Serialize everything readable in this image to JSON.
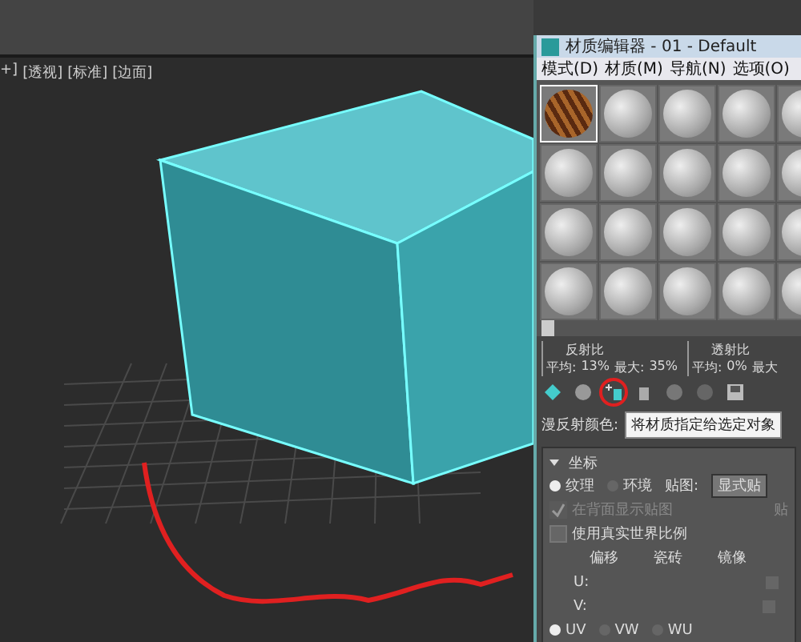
{
  "viewport": {
    "labels": [
      "+]",
      "[透视]",
      "[标准]",
      "[边面]"
    ]
  },
  "material_editor": {
    "title": "材质编辑器 - 01 - Default",
    "menu": [
      "模式(D)",
      "材质(M)",
      "导航(N)",
      "选项(O)"
    ],
    "slots": [
      {
        "kind": "wood",
        "selected": true
      },
      {
        "kind": "gray",
        "selected": false
      },
      {
        "kind": "gray",
        "selected": false
      },
      {
        "kind": "gray",
        "selected": false
      },
      {
        "kind": "gray",
        "selected": false
      },
      {
        "kind": "gray",
        "selected": false
      },
      {
        "kind": "gray",
        "selected": false
      },
      {
        "kind": "gray",
        "selected": false
      },
      {
        "kind": "gray",
        "selected": false
      },
      {
        "kind": "gray",
        "selected": false
      },
      {
        "kind": "gray",
        "selected": false
      },
      {
        "kind": "gray",
        "selected": false
      },
      {
        "kind": "gray",
        "selected": false
      },
      {
        "kind": "gray",
        "selected": false
      },
      {
        "kind": "gray",
        "selected": false
      },
      {
        "kind": "gray",
        "selected": false
      },
      {
        "kind": "gray",
        "selected": false
      },
      {
        "kind": "gray",
        "selected": false
      },
      {
        "kind": "gray",
        "selected": false
      },
      {
        "kind": "gray",
        "selected": false
      }
    ],
    "reflect": {
      "title": "反射比",
      "avg_label": "平均:",
      "avg": "13%",
      "max_label": "最大:",
      "max": "35%"
    },
    "transmit": {
      "title": "透射比",
      "avg_label": "平均:",
      "avg": "0%",
      "max_label": "最大"
    },
    "diffuse_label": "漫反射颜色:",
    "tooltip": "将材质指定给选定对象",
    "rollout": {
      "title": "坐标",
      "expanded": true,
      "radios": [
        {
          "label": "纹理",
          "selected": true
        },
        {
          "label": "环境",
          "selected": false
        }
      ],
      "map_label": "贴图:",
      "map_value": "显式贴",
      "map_right": "贴",
      "checks": [
        {
          "label": "在背面显示贴图",
          "checked": true,
          "disabled": true
        },
        {
          "label": "使用真实世界比例",
          "checked": false,
          "disabled": false
        }
      ],
      "columns": [
        "偏移",
        "瓷砖",
        "镜像"
      ],
      "rows": [
        {
          "label": "U:",
          "mirror": false
        },
        {
          "label": "V:",
          "mirror": false
        }
      ],
      "uv_radios": [
        {
          "label": "UV",
          "selected": true
        },
        {
          "label": "VW",
          "selected": false
        },
        {
          "label": "WU",
          "selected": false
        }
      ]
    }
  }
}
